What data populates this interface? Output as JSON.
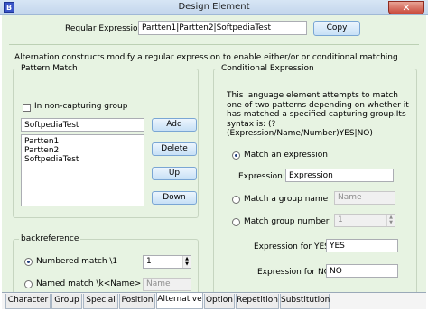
{
  "window": {
    "title": "Design Element",
    "icon": "app-icon",
    "close_glyph": "✕"
  },
  "regex": {
    "label": "Regular Expression:",
    "value": "Partten1|Partten2|SoftpediaTest",
    "copy_label": "Copy"
  },
  "description": "Alternation constructs modify a regular expression to enable either/or or conditional matching",
  "pattern_match": {
    "title": "Pattern Match",
    "non_capturing_label": "In non-capturing group",
    "non_capturing_checked": false,
    "input_value": "SoftpediaTest",
    "items": [
      "Partten1",
      "Partten2",
      "SoftpediaTest"
    ],
    "buttons": {
      "add": "Add",
      "delete": "Delete",
      "up": "Up",
      "down": "Down"
    }
  },
  "backreference": {
    "title": "backreference",
    "numbered_label": "Numbered match  \\1",
    "numbered_value": "1",
    "named_label": "Named match  \\k<Name>",
    "named_placeholder": "Name",
    "selected": "numbered"
  },
  "conditional": {
    "title": "Conditional Expression",
    "description": "This language element attempts to match one of two patterns depending on whether it has matched a specified capturing group.Its syntax is: (?(Expression/Name/Number)YES|NO)",
    "match_expression_label": "Match an expression",
    "expression_label": "Expression:",
    "expression_value": "Expression",
    "match_group_name_label": "Match a group name",
    "group_name_placeholder": "Name",
    "match_group_number_label": "Match group number",
    "group_number_value": "1",
    "yes_label": "Expression for YES:",
    "yes_value": "YES",
    "no_label": "Expression for NO:",
    "no_value": "NO",
    "selected": "expression"
  },
  "tabs": [
    "Character",
    "Group",
    "Special",
    "Position",
    "Alternative",
    "Option",
    "Repetition",
    "Substitution"
  ],
  "active_tab": "Alternative"
}
